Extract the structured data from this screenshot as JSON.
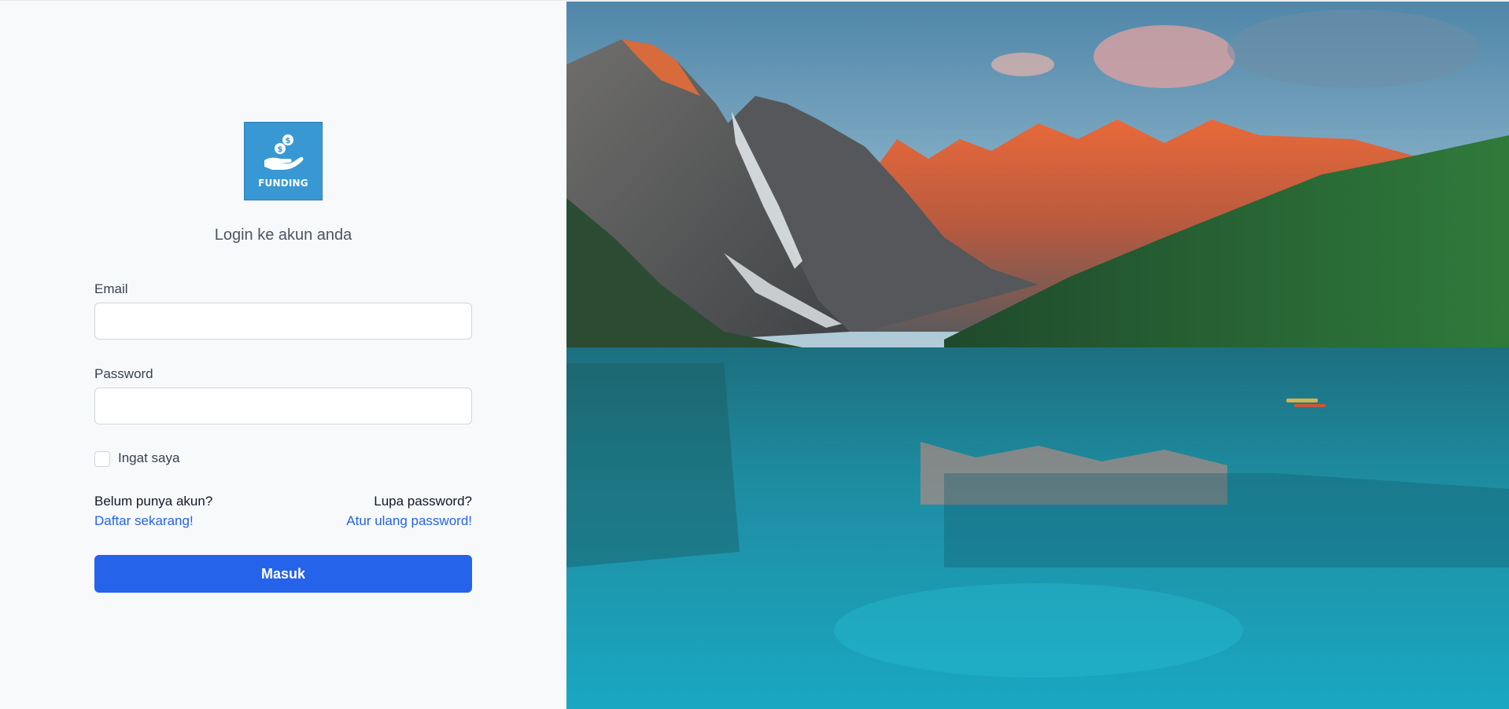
{
  "theme": {
    "left_bg": "#f8f9fb",
    "logo_bg": "#3898d3",
    "primary": "#2563eb",
    "link": "#2563eb"
  },
  "logo": {
    "icon": "hand-holding-coins-icon",
    "text": "FUNDING"
  },
  "login": {
    "title": "Login ke akun anda",
    "email_label": "Email",
    "email_value": "",
    "password_label": "Password",
    "password_value": "",
    "remember_label": "Ingat saya",
    "remember_checked": false,
    "no_account_text": "Belum punya akun?",
    "register_link": "Daftar sekarang!",
    "forgot_text": "Lupa password?",
    "reset_link": "Atur ulang password!",
    "submit_label": "Masuk"
  },
  "hero_image": {
    "subject": "mountain-lake-landscape"
  }
}
